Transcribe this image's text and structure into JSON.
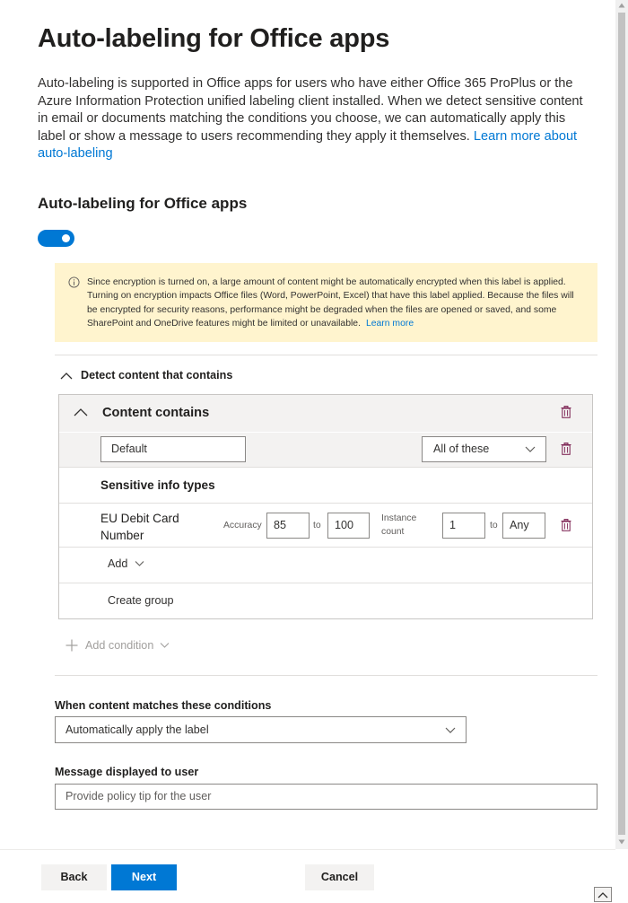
{
  "header": {
    "title": "Auto-labeling for Office apps",
    "description": "Auto-labeling is supported in Office apps for users who have either Office 365 ProPlus or the Azure Information Protection unified labeling client installed. When we detect sensitive content in email or documents matching the conditions you choose, we can automatically apply this label or show a message to users recommending they apply it themselves.",
    "learn_more_link": "Learn more about auto-labeling"
  },
  "toggle": {
    "label": "Auto-labeling for Office apps",
    "state": "on"
  },
  "warning": {
    "text": "Since encryption is turned on, a large amount of content might be automatically encrypted when this label is applied. Turning on encryption impacts Office files (Word, PowerPoint, Excel) that have this label applied. Because the files will be encrypted for security reasons, performance might be degraded when the files are opened or saved, and some SharePoint and OneDrive features might be limited or unavailable.",
    "link": "Learn more"
  },
  "detect": {
    "header": "Detect content that contains",
    "content_contains": "Content contains",
    "group_name": "Default",
    "match_mode": "All of these",
    "sensitive_info_types_title": "Sensitive info types",
    "item": {
      "name": "EU Debit Card Number",
      "accuracy_label": "Accuracy",
      "accuracy_min": "85",
      "to_label": "to",
      "accuracy_max": "100",
      "instance_label": "Instance count",
      "instance_min": "1",
      "instance_max": "Any"
    },
    "add_label": "Add",
    "create_group_label": "Create group",
    "add_condition_label": "Add condition"
  },
  "action": {
    "label": "When content matches these conditions",
    "value": "Automatically apply the label"
  },
  "message": {
    "label": "Message displayed to user",
    "placeholder": "Provide policy tip for the user"
  },
  "footer": {
    "back": "Back",
    "next": "Next",
    "cancel": "Cancel"
  },
  "colors": {
    "accent": "#0078d4",
    "warning_bg": "#fff4ce",
    "trash_icon": "#7a1e4f"
  }
}
